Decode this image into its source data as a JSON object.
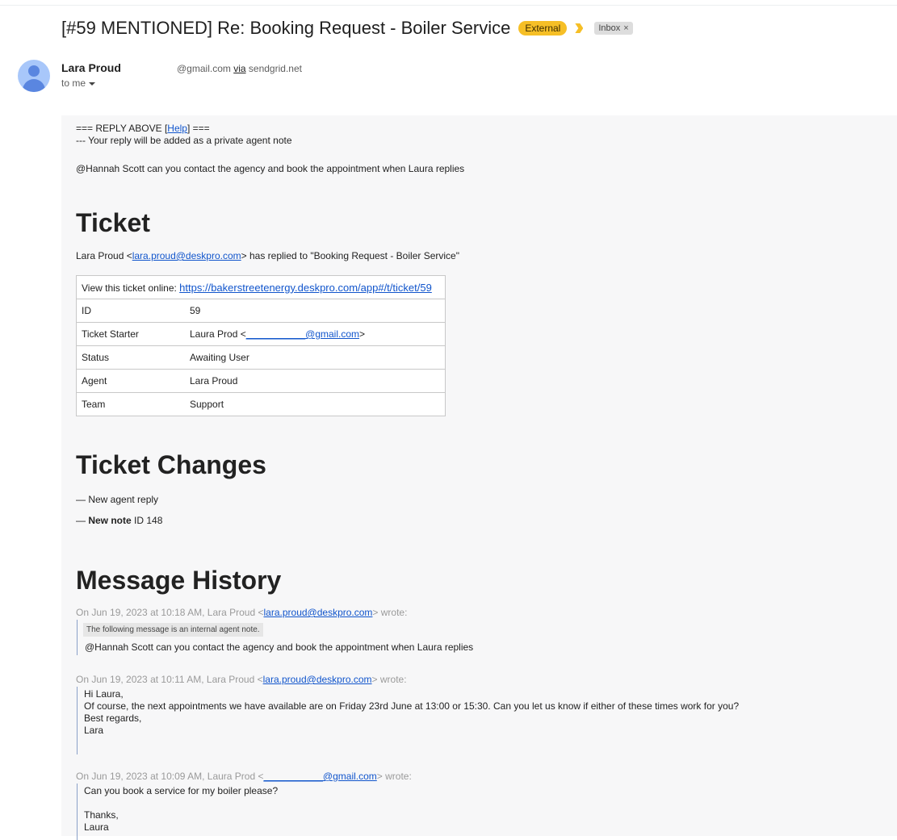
{
  "email": {
    "subject": "[#59 MENTIONED] Re: Booking Request - Boiler Service",
    "labels": {
      "external": "External",
      "inbox": "Inbox",
      "inbox_remove": "×"
    },
    "sender": {
      "name": "Lara Proud",
      "email_suffix": "@gmail.com",
      "via_label": "via",
      "via_domain": "sendgrid.net",
      "to": "to me"
    }
  },
  "body": {
    "reply_above_prefix": "===   REPLY ABOVE [",
    "help_link": "Help",
    "reply_above_suffix": "] ===",
    "private_note_line": "--- Your reply will be added as a private agent note",
    "mention_prefix": "@Hannah Scott can you",
    "mention_rest": " contact the agency and book the appointment when Laura replies",
    "ticket_heading": "Ticket",
    "replied_prefix": "Lara Proud <",
    "replied_email": "lara.proud@deskpro.com",
    "replied_suffix": "> has replied to \"Booking Request - Boiler Service\"",
    "view_online_label": "View this ticket online: ",
    "view_online_url": "https://bakerstreetenergy.deskpro.com/app#/t/ticket/59",
    "ticket_rows": [
      {
        "key": "ID",
        "value": "59"
      },
      {
        "key": "Ticket Starter",
        "value_prefix": "Laura Prod <",
        "value_link": "___________@gmail.com",
        "value_suffix": ">"
      },
      {
        "key": "Status",
        "value": "Awaiting User"
      },
      {
        "key": "Agent",
        "value": "Lara Proud"
      },
      {
        "key": "Team",
        "value": "Support"
      }
    ],
    "changes_heading": "Ticket Changes",
    "change_1": "— New agent reply",
    "change_2_prefix": "— ",
    "change_2_bold": "New note",
    "change_2_rest": " ID 148",
    "history_heading": "Message History",
    "history": [
      {
        "header_prefix": "On Jun 19, 2023 at 10:18 AM, Lara Proud <",
        "header_email": "lara.proud@deskpro.com",
        "header_suffix": "> wrote:",
        "internal_note": "The following message is an internal agent note.",
        "line_mention": "@Hannah Scott can you",
        "line_rest": " contact the agency and book the appointment when Laura replies"
      },
      {
        "header_prefix": "On Jun 19, 2023 at 10:11 AM, Lara Proud <",
        "header_email": "lara.proud@deskpro.com",
        "header_suffix": "> wrote:",
        "lines": [
          "Hi Laura,",
          "Of course, the next appointments we have available are on Friday 23rd June at 13:00 or 15:30. Can you let us know if either of these times work for you?",
          "Best regards,",
          "Lara"
        ]
      },
      {
        "header_prefix": "On Jun 19, 2023 at 10:09 AM, Laura Prod <",
        "header_email": "___________@gmail.com",
        "header_suffix": "> wrote:",
        "lines": [
          "Can you book a service for my boiler please?",
          "",
          "Thanks,",
          "Laura"
        ]
      }
    ]
  }
}
